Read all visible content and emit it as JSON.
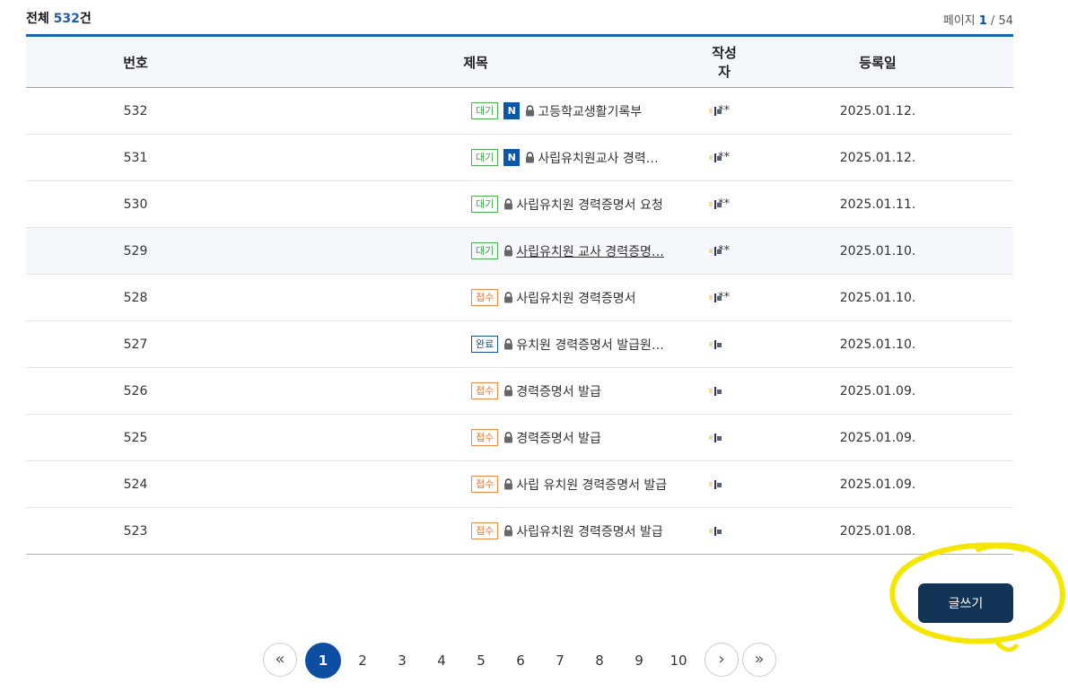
{
  "summary": {
    "total_prefix": "전체 ",
    "total_count": "532",
    "total_suffix": "건",
    "page_label": "페이지 ",
    "page_current": "1",
    "page_sep": " / ",
    "page_total": "54"
  },
  "columns": {
    "num": "번호",
    "subject": "제목",
    "writer": "작성자",
    "date": "등록일"
  },
  "rows": [
    {
      "num": "532",
      "status": "대기",
      "is_new": true,
      "title": "고등학교생활기록부",
      "writer_suffix": "**",
      "date": "2025.01.12."
    },
    {
      "num": "531",
      "status": "대기",
      "is_new": true,
      "title": "사립유치원교사 경력…",
      "writer_suffix": "**",
      "date": "2025.01.12."
    },
    {
      "num": "530",
      "status": "대기",
      "is_new": false,
      "title": "사립유치원 경력증명서 요청",
      "writer_suffix": "**",
      "date": "2025.01.11."
    },
    {
      "num": "529",
      "status": "대기",
      "is_new": false,
      "title": "사립유치원 교사 경력증명…",
      "writer_suffix": "**",
      "date": "2025.01.10."
    },
    {
      "num": "528",
      "status": "접수",
      "is_new": false,
      "title": "사립유치원 경력증명서",
      "writer_suffix": "**",
      "date": "2025.01.10."
    },
    {
      "num": "527",
      "status": "완료",
      "is_new": false,
      "title": "유치원 경력증명서 발급원…",
      "writer_suffix": "",
      "date": "2025.01.10."
    },
    {
      "num": "526",
      "status": "접수",
      "is_new": false,
      "title": "경력증명서 발급",
      "writer_suffix": "",
      "date": "2025.01.09."
    },
    {
      "num": "525",
      "status": "접수",
      "is_new": false,
      "title": "경력증명서 발급",
      "writer_suffix": "",
      "date": "2025.01.09."
    },
    {
      "num": "524",
      "status": "접수",
      "is_new": false,
      "title": "사립 유치원 경력증명서 발급",
      "writer_suffix": "",
      "date": "2025.01.09."
    },
    {
      "num": "523",
      "status": "접수",
      "is_new": false,
      "title": "사립유치원 경력증명서 발급",
      "writer_suffix": "",
      "date": "2025.01.08."
    }
  ],
  "new_badge": "N",
  "write_button": "글쓰기",
  "pagination": {
    "first": "«",
    "prev": "‹",
    "next": "›",
    "last": "»",
    "pages": [
      "1",
      "2",
      "3",
      "4",
      "5",
      "6",
      "7",
      "8",
      "9",
      "10"
    ],
    "current": "1"
  },
  "colors": {
    "accent": "#0b4ea2",
    "wait": "#4caf50",
    "received": "#e98a45",
    "done": "#1a4f9a",
    "button": "#123456",
    "highlight_circle": "#f5e600"
  },
  "icons": {
    "lock": "lock-icon",
    "first": "double-chevron-left-icon",
    "prev": "chevron-left-icon",
    "next": "chevron-right-icon",
    "last": "double-chevron-right-icon"
  }
}
